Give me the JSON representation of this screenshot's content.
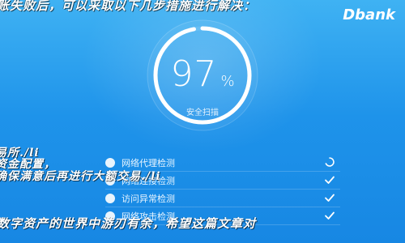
{
  "overlay": {
    "top": "账失败后，可以采取以下几步措施进行解决：",
    "line_1": "易所./li",
    "line_2": "资金配置，",
    "line_3": "确保满意后再进行大额交易./li",
    "bottom": "数字资产的世界中游刃有余，希望这篇文章对"
  },
  "brand": "Dbank",
  "scanner": {
    "score": "97",
    "unit": "%",
    "status": "安全扫描",
    "progress": 0.97
  },
  "checks": [
    {
      "label": "网络代理检测",
      "status": "in-progress"
    },
    {
      "label": "网络连接检测",
      "status": "done"
    },
    {
      "label": "访问异常检测",
      "status": "done"
    },
    {
      "label": "网络攻击检测",
      "status": "done"
    }
  ],
  "colors": {
    "background_top": "#3fb2f3",
    "background_bottom": "#1787e3",
    "ring_track": "#7cc8f8",
    "ring_fill": "#ffffff"
  }
}
